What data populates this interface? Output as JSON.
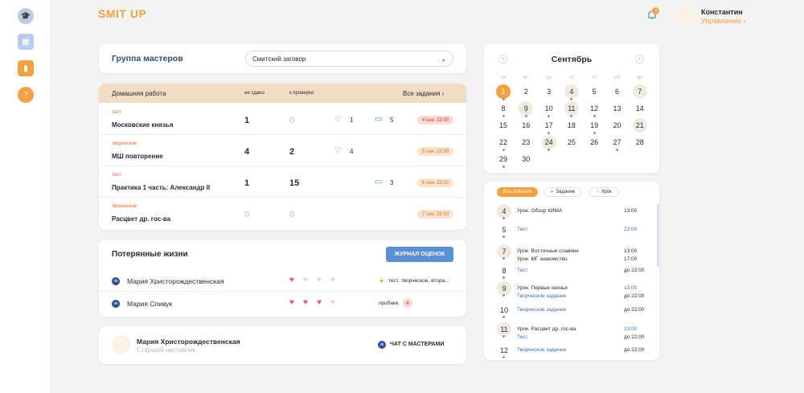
{
  "logo": "SMIT UP",
  "notifications": {
    "count": "3"
  },
  "user": {
    "name": "Константин",
    "role": "Управление ›"
  },
  "group": {
    "title": "Группа мастеров",
    "selected": "Смитский заговор"
  },
  "homework": {
    "title": "Домашняя работа",
    "col_not": "не сдано",
    "col_check": "к проверке",
    "all": "Все задания ›",
    "rows": [
      {
        "tag": "тест",
        "name": "Московские князья",
        "not": "1",
        "check": "0",
        "hearts": "1",
        "comments": "5",
        "date": "4 сен. 22:00"
      },
      {
        "tag": "творческое",
        "name": "МШ повторение",
        "not": "4",
        "check": "2",
        "hearts": "4",
        "comments": "",
        "date": "5 сен. 22:00"
      },
      {
        "tag": "тест",
        "name": "Практика 1 часть: Александр II",
        "not": "1",
        "check": "15",
        "hearts": "",
        "comments": "3",
        "date": "6 сен. 22:00"
      },
      {
        "tag": "творческое",
        "name": "Расцвет др. гос-ва",
        "not": "0",
        "check": "0",
        "hearts": "",
        "comments": "",
        "date": "7 сен. 22:00"
      }
    ]
  },
  "lives": {
    "title": "Потерянные жизни",
    "button": "ЖУРНАЛ ОЦЕНОК",
    "rows": [
      {
        "name": "Мария Христорождественская",
        "note": "тест, творческое, втора..."
      },
      {
        "name": "Мария Спивук",
        "note": "пробник",
        "badge": "4"
      }
    ]
  },
  "mentor": {
    "name": "Мария Христорождественская",
    "role": "Старший наставник",
    "chat": "ЧАТ С МАСТЕРАМИ"
  },
  "calendar": {
    "month": "Сентябрь",
    "weekdays": [
      "пн",
      "вт",
      "ср",
      "чт",
      "пт",
      "сб",
      "вс"
    ],
    "weeks": [
      [
        "1",
        "2",
        "3",
        "4",
        "5",
        "6",
        "7"
      ],
      [
        "8",
        "9",
        "10",
        "11",
        "12",
        "13",
        "14"
      ],
      [
        "15",
        "16",
        "17",
        "18",
        "19",
        "20",
        "21"
      ],
      [
        "22",
        "23",
        "24",
        "25",
        "26",
        "27",
        "28"
      ],
      [
        "29",
        "30",
        "",
        "",
        "",
        "",
        ""
      ]
    ]
  },
  "events": {
    "filters": [
      "Все события",
      "Задание",
      "Урок"
    ],
    "items": [
      {
        "day": "4",
        "lines": [
          "Урок. Обзор КИМА"
        ],
        "times": [
          "13:00"
        ]
      },
      {
        "day": "5",
        "lines": [
          "Тест"
        ],
        "times": [
          "22:00"
        ]
      },
      {
        "day": "7",
        "lines": [
          "Урок. Восточные славяне",
          "Урок. МГ знакомство"
        ],
        "times": [
          "13:00",
          "17:00"
        ]
      },
      {
        "day": "8",
        "lines": [
          "Тест"
        ],
        "times": [
          "до 22:00"
        ]
      },
      {
        "day": "9",
        "lines": [
          "Урок. Первые князья",
          "Творческое задание"
        ],
        "times": [
          "13:00",
          "до 22:00"
        ]
      },
      {
        "day": "10",
        "lines": [
          "Творческое задание"
        ],
        "times": [
          "до 22:00"
        ]
      },
      {
        "day": "11",
        "lines": [
          "Урок. Расцвет др. гос-ва",
          "Тест"
        ],
        "times": [
          "13:00",
          "до 22:00"
        ]
      },
      {
        "day": "12",
        "lines": [
          "Творческое задание"
        ],
        "times": [
          "до 22:00"
        ]
      }
    ]
  },
  "colors": {
    "accent": "#f5a142",
    "blue": "#5b8fd6",
    "heart": "#ea4f85",
    "heart_light": "#f6c9d9"
  }
}
